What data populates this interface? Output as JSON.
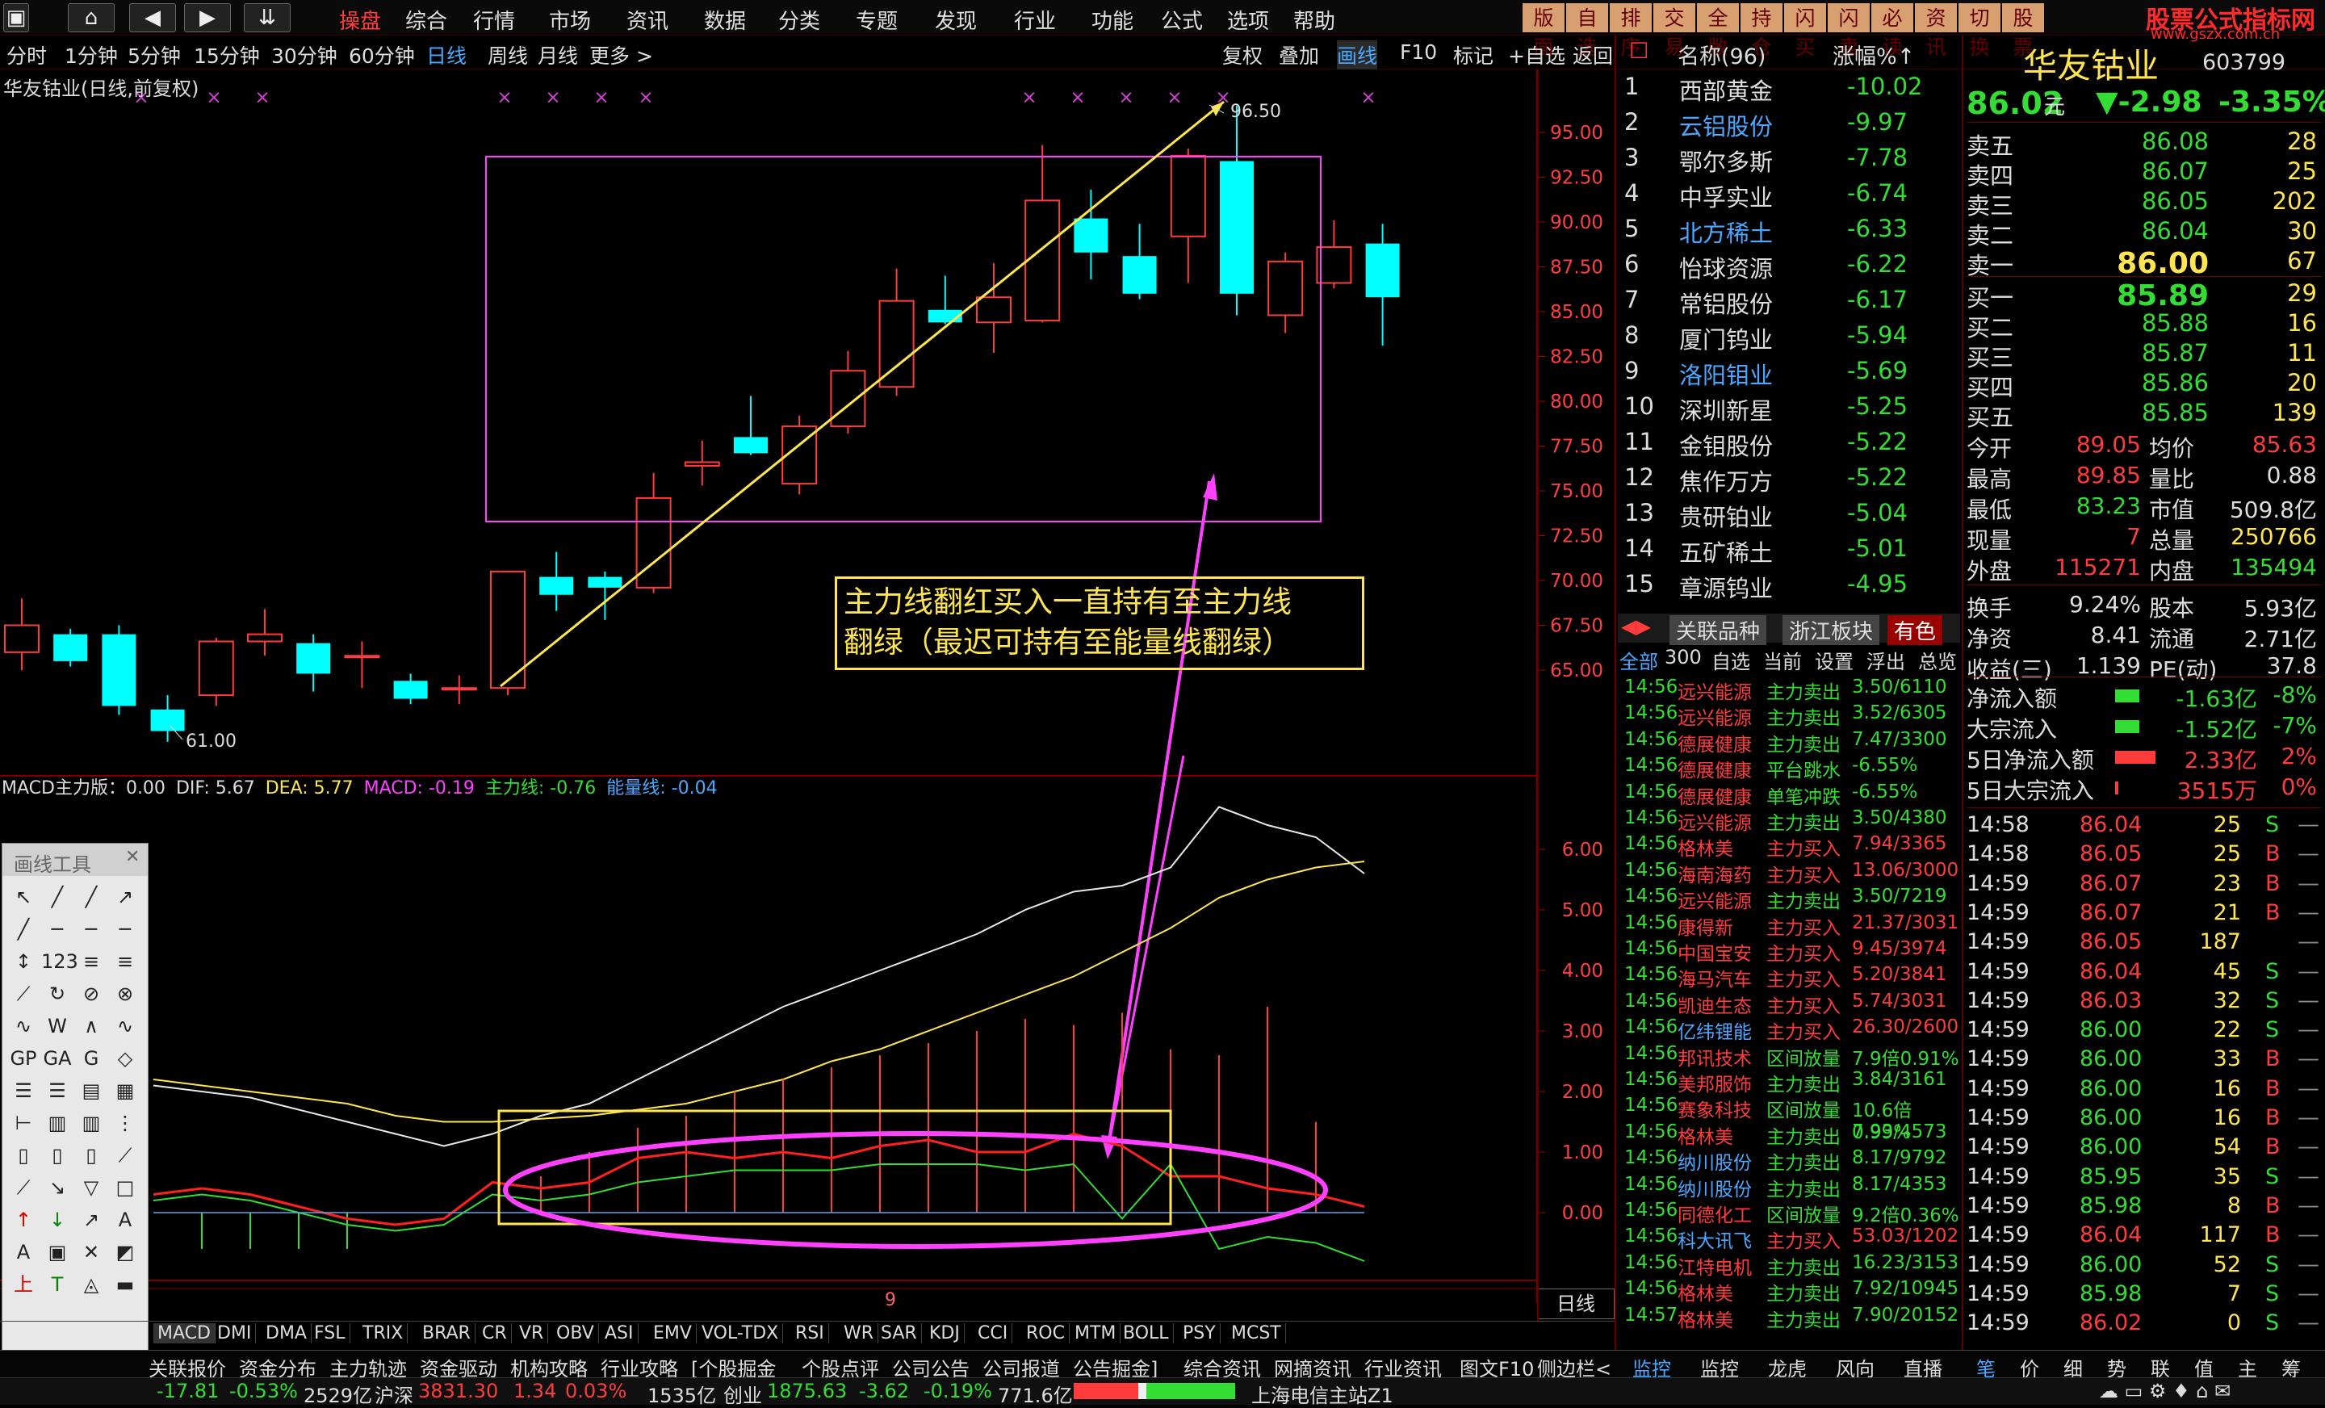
{
  "nav": {
    "home": "⌂",
    "back": "◀",
    "fwd": "▶",
    "more": "⇊"
  },
  "menu": [
    "操盘",
    "综合",
    "行情",
    "市场",
    "资讯",
    "数据",
    "分类",
    "专题",
    "发现",
    "行业",
    "功能",
    "公式",
    "选项",
    "帮助"
  ],
  "quick_buttons": [
    "版面",
    "自选",
    "排序",
    "交易",
    "全敞",
    "持仓",
    "闪买",
    "闪卖",
    "必读",
    "资讯",
    "切换",
    "股票"
  ],
  "watermark": "股票公式指标网",
  "watermark_url": "www.gszx.com.cn",
  "periods": [
    "分时",
    "1分钟",
    "5分钟",
    "15分钟",
    "30分钟",
    "60分钟",
    "日线",
    "周线",
    "月线",
    "更多 >"
  ],
  "tools": [
    "复权",
    "叠加",
    "画线",
    "F10",
    "标记",
    "+自选",
    "返回"
  ],
  "chart": {
    "title": "华友钴业(日线,前复权)",
    "high_label": "96.50",
    "low_label": "61.00",
    "price_ticks": [
      "95.00",
      "92.50",
      "90.00",
      "87.50",
      "85.00",
      "82.50",
      "80.00",
      "77.50",
      "75.00",
      "72.50",
      "70.00",
      "67.50",
      "65.00"
    ],
    "annotation_line1": "主力线翻红买入一直持有至主力线",
    "annotation_line2": "翻绿（最迟可持有至能量线翻绿）",
    "macd_label": "MACD主力版：0.00",
    "dif": "DIF: 5.67",
    "dea": "DEA: 5.77",
    "macd": "MACD: -0.19",
    "main": "主力线: -0.76",
    "energy": "能量线: -0.04",
    "macd_ticks": [
      "6.00",
      "5.00",
      "4.00",
      "3.00",
      "2.00",
      "1.00",
      "0.00"
    ],
    "x_label": "9",
    "period_label": "日线"
  },
  "chart_data": {
    "type": "candlestick",
    "series": [
      {
        "o": 66.0,
        "c": 67.5,
        "h": 69.0,
        "l": 65.0
      },
      {
        "o": 67.0,
        "c": 65.5,
        "h": 67.3,
        "l": 65.2
      },
      {
        "o": 67.0,
        "c": 63.0,
        "h": 67.5,
        "l": 62.5
      },
      {
        "o": 62.8,
        "c": 61.6,
        "h": 63.6,
        "l": 61.0
      },
      {
        "o": 63.6,
        "c": 66.6,
        "h": 66.8,
        "l": 63.0
      },
      {
        "o": 66.6,
        "c": 67.0,
        "h": 68.4,
        "l": 65.8
      },
      {
        "o": 66.5,
        "c": 64.8,
        "h": 67.0,
        "l": 63.8
      },
      {
        "o": 65.8,
        "c": 65.8,
        "h": 66.6,
        "l": 64.0
      },
      {
        "o": 64.4,
        "c": 63.4,
        "h": 64.8,
        "l": 63.1
      },
      {
        "o": 64.0,
        "c": 64.0,
        "h": 64.7,
        "l": 63.1
      },
      {
        "o": 64.0,
        "c": 70.5,
        "h": 70.5,
        "l": 63.6
      },
      {
        "o": 70.2,
        "c": 69.2,
        "h": 71.6,
        "l": 68.3
      },
      {
        "o": 70.2,
        "c": 69.6,
        "h": 70.5,
        "l": 67.8
      },
      {
        "o": 69.6,
        "c": 74.6,
        "h": 76.0,
        "l": 69.3
      },
      {
        "o": 76.4,
        "c": 76.6,
        "h": 77.8,
        "l": 75.3
      },
      {
        "o": 78.0,
        "c": 77.1,
        "h": 80.3,
        "l": 77.0
      },
      {
        "o": 75.4,
        "c": 78.6,
        "h": 79.2,
        "l": 74.8
      },
      {
        "o": 78.6,
        "c": 81.7,
        "h": 82.8,
        "l": 78.2
      },
      {
        "o": 80.8,
        "c": 85.6,
        "h": 87.4,
        "l": 80.3
      },
      {
        "o": 85.1,
        "c": 84.4,
        "h": 87.0,
        "l": 84.3
      },
      {
        "o": 84.4,
        "c": 85.8,
        "h": 87.7,
        "l": 82.7
      },
      {
        "o": 84.5,
        "c": 91.2,
        "h": 94.3,
        "l": 84.4
      },
      {
        "o": 90.2,
        "c": 88.3,
        "h": 91.8,
        "l": 86.8
      },
      {
        "o": 88.1,
        "c": 86.0,
        "h": 89.9,
        "l": 85.7
      },
      {
        "o": 89.2,
        "c": 93.7,
        "h": 94.1,
        "l": 86.6
      },
      {
        "o": 93.4,
        "c": 86.0,
        "h": 96.5,
        "l": 84.8
      },
      {
        "o": 84.8,
        "c": 87.8,
        "h": 88.3,
        "l": 83.8
      },
      {
        "o": 86.6,
        "c": 88.6,
        "h": 90.1,
        "l": 86.3
      },
      {
        "o": 88.8,
        "c": 85.8,
        "h": 89.9,
        "l": 83.1
      }
    ]
  },
  "rank": {
    "col_name": "名称(96)",
    "col_chg": "涨幅%↑",
    "items": [
      {
        "n": "1",
        "name": "西部黄金",
        "chg": "-10.02"
      },
      {
        "n": "2",
        "name": "云铝股份",
        "chg": "-9.97"
      },
      {
        "n": "3",
        "name": "鄂尔多斯",
        "chg": "-7.78"
      },
      {
        "n": "4",
        "name": "中孚实业",
        "chg": "-6.74"
      },
      {
        "n": "5",
        "name": "北方稀土",
        "chg": "-6.33"
      },
      {
        "n": "6",
        "name": "怡球资源",
        "chg": "-6.22"
      },
      {
        "n": "7",
        "name": "常铝股份",
        "chg": "-6.17"
      },
      {
        "n": "8",
        "name": "厦门钨业",
        "chg": "-5.94"
      },
      {
        "n": "9",
        "name": "洛阳钼业",
        "chg": "-5.69"
      },
      {
        "n": "10",
        "name": "深圳新星",
        "chg": "-5.25"
      },
      {
        "n": "11",
        "name": "金钼股份",
        "chg": "-5.22"
      },
      {
        "n": "12",
        "name": "焦作万方",
        "chg": "-5.22"
      },
      {
        "n": "13",
        "name": "贵研铂业",
        "chg": "-5.04"
      },
      {
        "n": "14",
        "name": "五矿稀土",
        "chg": "-5.01"
      },
      {
        "n": "15",
        "name": "章源钨业",
        "chg": "-4.95"
      }
    ],
    "tabs": [
      "关联品种",
      "浙江板块",
      "有色"
    ],
    "subtabs": [
      "全部",
      "300",
      "自选",
      "当前",
      "设置",
      "浮出",
      "总览"
    ]
  },
  "ticks": [
    [
      "14:56",
      "远兴能源",
      "主力卖出",
      "3.50/6110"
    ],
    [
      "14:56",
      "远兴能源",
      "主力卖出",
      "3.52/6305"
    ],
    [
      "14:56",
      "德展健康",
      "主力卖出",
      "7.47/3300"
    ],
    [
      "14:56",
      "德展健康",
      "平台跳水",
      "-6.55%"
    ],
    [
      "14:56",
      "德展健康",
      "单笔冲跌",
      "-6.55%"
    ],
    [
      "14:56",
      "远兴能源",
      "主力卖出",
      "3.50/4380"
    ],
    [
      "14:56",
      "格林美",
      "主力买入",
      "7.94/3365"
    ],
    [
      "14:56",
      "海南海药",
      "主力买入",
      "13.06/3000"
    ],
    [
      "14:56",
      "远兴能源",
      "主力卖出",
      "3.50/7219"
    ],
    [
      "14:56",
      "康得新",
      "主力买入",
      "21.37/3031"
    ],
    [
      "14:56",
      "中国宝安",
      "主力买入",
      "9.45/3974"
    ],
    [
      "14:56",
      "海马汽车",
      "主力买入",
      "5.20/3841"
    ],
    [
      "14:56",
      "凯迪生态",
      "主力买入",
      "5.74/3031"
    ],
    [
      "14:56",
      "亿纬锂能",
      "主力买入",
      "26.30/2600"
    ],
    [
      "14:56",
      "邦讯技术",
      "区间放量",
      "7.9倍0.91%"
    ],
    [
      "14:56",
      "美邦服饰",
      "主力卖出",
      "3.84/3161"
    ],
    [
      "14:56",
      "赛象科技",
      "区间放量",
      "10.6倍0.99%"
    ],
    [
      "14:56",
      "格林美",
      "主力卖出",
      "7.93/4573"
    ],
    [
      "14:56",
      "纳川股份",
      "主力卖出",
      "8.17/9792"
    ],
    [
      "14:56",
      "纳川股份",
      "主力卖出",
      "8.17/4353"
    ],
    [
      "14:56",
      "同德化工",
      "区间放量",
      "9.2倍0.36%"
    ],
    [
      "14:56",
      "科大讯飞",
      "主力买入",
      "53.03/1202"
    ],
    [
      "14:56",
      "江特电机",
      "主力卖出",
      "16.23/3153"
    ],
    [
      "14:56",
      "格林美",
      "主力卖出",
      "7.92/10945"
    ],
    [
      "14:57",
      "格林美",
      "主力卖出",
      "7.90/20152"
    ]
  ],
  "stock": {
    "name": "华友钴业",
    "code": "603799",
    "price": "86.02",
    "unit": "元",
    "change": "▼-2.98",
    "pct": "-3.35%",
    "sells": [
      [
        "卖五",
        "86.08",
        "28"
      ],
      [
        "卖四",
        "86.07",
        "25"
      ],
      [
        "卖三",
        "86.05",
        "202"
      ],
      [
        "卖二",
        "86.04",
        "30"
      ],
      [
        "卖一",
        "86.00",
        "67"
      ]
    ],
    "buys": [
      [
        "买一",
        "85.89",
        "29"
      ],
      [
        "买二",
        "85.88",
        "16"
      ],
      [
        "买三",
        "85.87",
        "11"
      ],
      [
        "买四",
        "85.86",
        "20"
      ],
      [
        "买五",
        "85.85",
        "139"
      ]
    ],
    "stats": [
      [
        "今开",
        "89.05",
        "均价",
        "85.63"
      ],
      [
        "最高",
        "89.85",
        "量比",
        "0.88"
      ],
      [
        "最低",
        "83.23",
        "市值",
        "509.8亿"
      ],
      [
        "现量",
        "7",
        "总量",
        "250766"
      ],
      [
        "外盘",
        "115271",
        "内盘",
        "135494"
      ],
      [
        "换手",
        "9.24%",
        "股本",
        "5.93亿"
      ],
      [
        "净资",
        "8.41",
        "流通",
        "2.71亿"
      ],
      [
        "收益(三)",
        "1.139",
        "PE(动)",
        "37.8"
      ]
    ],
    "flows": [
      [
        "净流入额",
        "-1.63亿",
        "-8%"
      ],
      [
        "大宗流入",
        "-1.52亿",
        "-7%"
      ],
      [
        "5日净流入额",
        "2.33亿",
        "2%"
      ],
      [
        "5日大宗流入",
        "3515万",
        "0%"
      ]
    ],
    "trades": [
      [
        "14:58",
        "86.04",
        "25",
        "S"
      ],
      [
        "14:58",
        "86.05",
        "25",
        "B"
      ],
      [
        "14:59",
        "86.07",
        "23",
        "B"
      ],
      [
        "14:59",
        "86.07",
        "21",
        "B"
      ],
      [
        "14:59",
        "86.05",
        "187",
        ""
      ],
      [
        "14:59",
        "86.04",
        "45",
        "S"
      ],
      [
        "14:59",
        "86.03",
        "32",
        "S"
      ],
      [
        "14:59",
        "86.00",
        "22",
        "S"
      ],
      [
        "14:59",
        "86.00",
        "33",
        "B"
      ],
      [
        "14:59",
        "86.00",
        "16",
        "B"
      ],
      [
        "14:59",
        "86.00",
        "16",
        "B"
      ],
      [
        "14:59",
        "86.00",
        "54",
        "B"
      ],
      [
        "14:59",
        "85.95",
        "35",
        "S"
      ],
      [
        "14:59",
        "85.98",
        "8",
        "B"
      ],
      [
        "14:59",
        "86.04",
        "117",
        "B"
      ],
      [
        "14:59",
        "86.00",
        "52",
        "S"
      ],
      [
        "14:59",
        "85.98",
        "7",
        "S"
      ],
      [
        "14:59",
        "86.02",
        "0",
        "S"
      ]
    ]
  },
  "indicators": [
    "MACD",
    "DMI",
    "DMA",
    "FSL",
    "TRIX",
    "BRAR",
    "CR",
    "VR",
    "OBV",
    "ASI",
    "EMV",
    "VOL-TDX",
    "RSI",
    "WR",
    "SAR",
    "KDJ",
    "CCI",
    "ROC",
    "MTM",
    "BOLL",
    "PSY",
    "MCST"
  ],
  "bottom_tabs": [
    "关联报价",
    "资金分布",
    "主力轨迹",
    "资金驱动",
    "机构攻略",
    "行业攻略",
    "[个股掘金",
    "个股点评",
    "公司公告",
    "公司报道",
    "公告掘金]",
    "综合资讯",
    "网摘资讯",
    "行业资讯"
  ],
  "bottom_right": [
    "图文F10",
    "侧边栏<"
  ],
  "right_tabs": [
    "监控",
    "监控",
    "龙虎",
    "风向",
    "直播"
  ],
  "right_tabs2": [
    "笔",
    "价",
    "细",
    "势",
    "联",
    "值",
    "主",
    "筹"
  ],
  "status": {
    "s1": "-17.81",
    "s2": "-0.53%",
    "s3": "2529亿",
    "sh_label": "沪深",
    "sh_val": "3831.30",
    "sh_chg": "1.34",
    "sh_pct": "0.03%",
    "sh_amt": "1535亿",
    "cy_label": "创业",
    "cy_val": "1875.63",
    "cy_chg": "-3.62",
    "cy_pct": "-0.19%",
    "cy_amt": "771.6亿",
    "server": "上海电信主站Z1"
  },
  "drawtools_title": "画线工具",
  "colors": {
    "up": "#ff3c3c",
    "down": "#00ffff",
    "accent": "#4aa8ff",
    "yellow": "#ffe650",
    "green": "#33dd33",
    "magenta": "#ff40ff"
  }
}
